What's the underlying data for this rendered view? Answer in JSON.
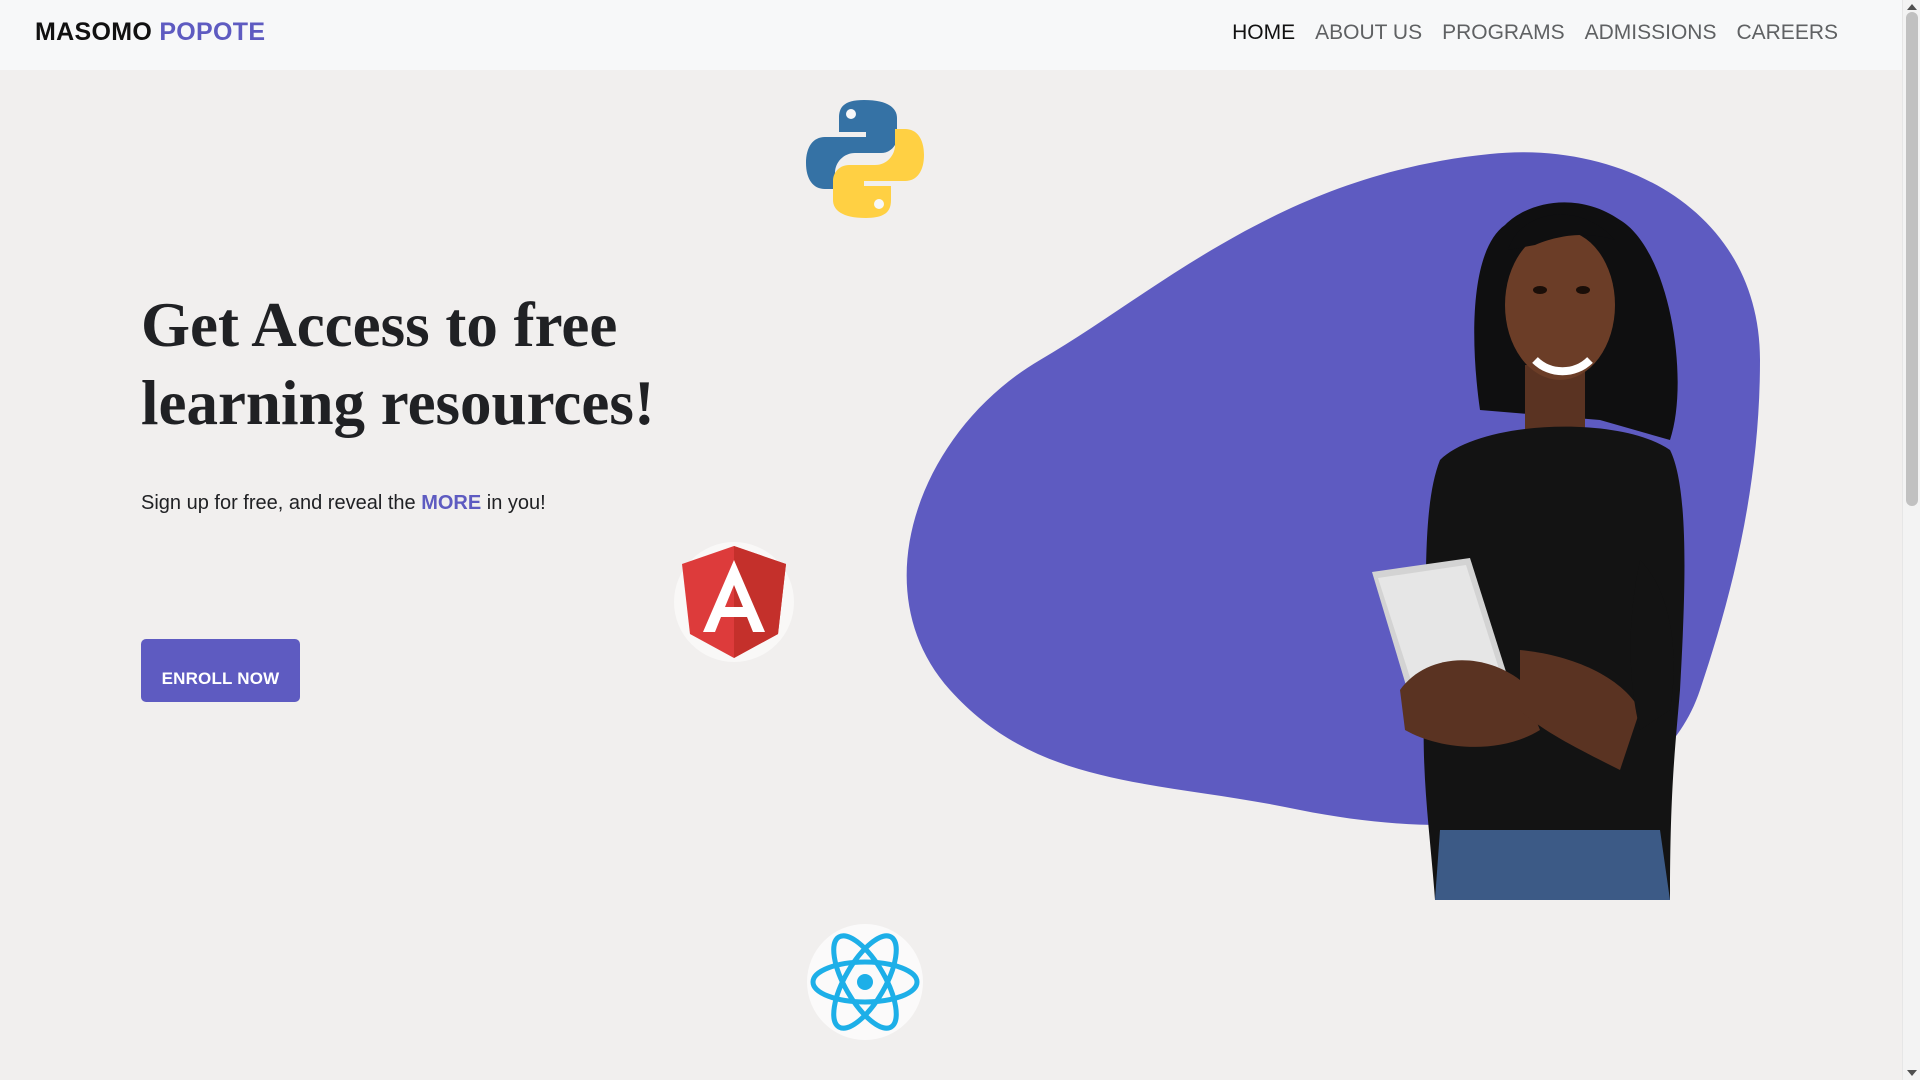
{
  "brand": {
    "main": "MASOMO",
    "accent": "POPOTE"
  },
  "nav": {
    "items": [
      {
        "label": "HOME",
        "active": true
      },
      {
        "label": "ABOUT US",
        "active": false
      },
      {
        "label": "PROGRAMS",
        "active": false
      },
      {
        "label": "ADMISSIONS",
        "active": false
      },
      {
        "label": "CAREERS",
        "active": false
      }
    ]
  },
  "hero": {
    "title": "Get Access to free learning resources!",
    "subtitle_before": "Sign up for free, and reveal the ",
    "subtitle_highlight": "MORE",
    "subtitle_after": " in you!",
    "cta_label": "ENROLL NOW"
  },
  "icons": [
    "python-logo-icon",
    "angular-logo-icon",
    "react-logo-icon"
  ],
  "colors": {
    "accent": "#5e5bc1",
    "background": "#f1efee",
    "navbar": "#f7f8f9",
    "text": "#202124"
  }
}
